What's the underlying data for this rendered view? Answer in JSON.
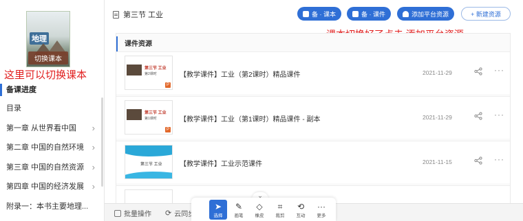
{
  "sidebar": {
    "cover": {
      "badge": "地理",
      "switch_label": "切换课本"
    },
    "annotation": "这里可以切换课本",
    "progress_title": "备课进度",
    "items": [
      {
        "label": "目录",
        "has_chevron": false
      },
      {
        "label": "第一章 从世界看中国",
        "has_chevron": true
      },
      {
        "label": "第二章 中国的自然环境",
        "has_chevron": true
      },
      {
        "label": "第三章 中国的自然资源",
        "has_chevron": true
      },
      {
        "label": "第四章 中国的经济发展",
        "has_chevron": true
      },
      {
        "label": "附录一：本书主要地理...",
        "has_chevron": false
      }
    ]
  },
  "header": {
    "breadcrumb": "第三节 工业",
    "buttons": {
      "bei_textbook": "备 · 课本",
      "bei_courseware": "备 · 课件",
      "add_platform": "添加平台资源",
      "new_resource": "+ 新建资源"
    },
    "annotation": "课本切换好了点击 添加平台资源"
  },
  "panel": {
    "title": "课件资源",
    "rows": [
      {
        "title": "【教学课件】工业（第2课时）精品课件",
        "date": "2021-11-29",
        "thumb": "photo",
        "thumb_title": "第三节 工业",
        "thumb_sub": "第2课时"
      },
      {
        "title": "【教学课件】工业（第1课时）精品课件 - 副本",
        "date": "2021-11-29",
        "thumb": "photo",
        "thumb_title": "第三节 工业",
        "thumb_sub": "第1课时"
      },
      {
        "title": "【教学课件】工业示范课件",
        "date": "2021-11-15",
        "thumb": "wave",
        "thumb_title": "第三节 工业",
        "thumb_sub": ""
      }
    ]
  },
  "bottombar": {
    "batch": "批量操作",
    "cloud": "云同步"
  },
  "dock": {
    "tools": [
      "选择",
      "画笔",
      "橡皮",
      "裁剪",
      "互动",
      "更多"
    ],
    "active_index": 0
  },
  "colors": {
    "accent": "#2f6fd6",
    "annotation": "#e11d1d"
  }
}
